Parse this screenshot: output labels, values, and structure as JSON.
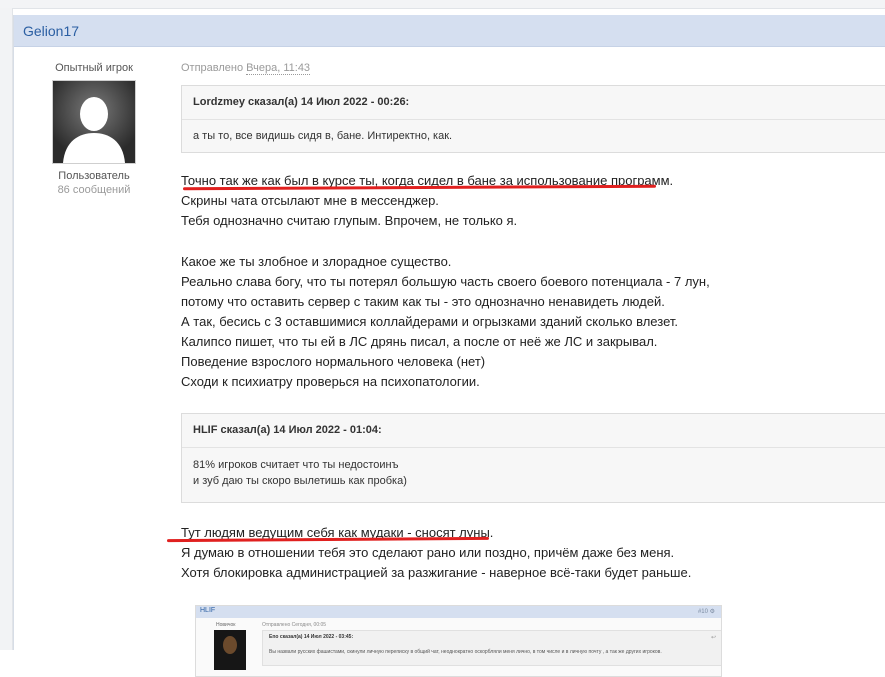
{
  "post": {
    "author": "Gelion17",
    "rank": "Опытный игрок",
    "group": "Пользователь",
    "post_count": "86 сообщений",
    "meta_prefix": "Отправлено",
    "meta_date": "Вчера, 11:43"
  },
  "quote1": {
    "header": "Lordzmey сказал(а) 14 Июл 2022 - 00:26:",
    "body": "а ты то, все видишь сидя в, бане. Интиректно, как."
  },
  "text_block1": [
    "Точно так же как был в курсе ты, когда сидел в бане за использование программ.",
    "Скрины чата отсылают мне в мессенджер.",
    "Тебя однозначно считаю глупым. Впрочем, не только я.",
    "",
    "Какое же ты злобное и злорадное существо.",
    "Реально слава богу, что ты потерял большую часть своего боевого потенциала - 7 лун,",
    "потому что оставить сервер с таким как ты - это однозначно ненавидеть людей.",
    "А так, бесись с 3 оставшимися коллайдерами и огрызками зданий сколько влезет.",
    "Калипсо пишет, что ты ей в ЛС дрянь писал, а после от неё же ЛС и закрывал.",
    "Поведение взрослого нормального человека (нет)",
    "Сходи к психиатру проверься на психопатологии."
  ],
  "quote2": {
    "header": "HLIF сказал(а) 14 Июл 2022 - 01:04:",
    "body_lines": [
      "81% игроков считает что ты недостоинъ",
      "и зуб даю ты скоро вылетишь как пробка)"
    ]
  },
  "text_block2": [
    "Тут людям ведущим себя как мудаки - сносят луны.",
    "Я думаю в отношении тебя это сделают рано или поздно, причём даже без меня.",
    "Хотя блокировка администрацией за разжигание - наверное всё-таки будет раньше."
  ],
  "embedded": {
    "name": "HLIF",
    "header_right": "#10 ⚙",
    "group": "Новичок",
    "meta": "Отправлено Сегодня, 00:05",
    "quote_header": "Eno сказал(а) 14 Июл 2022 - 03:45:",
    "quote_body": "Вы назвали русских фашистами, скинули личную переписку в общий чат, неоднократно оскорбляли меня лично, в том числе и в личную почту , а так же других игроков.",
    "quote_icon": "↩"
  },
  "colors": {
    "header_bg": "#d5dff0",
    "author_link": "#2a5ea2",
    "underline": "#e0201f"
  },
  "icons": {
    "avatar": "user-silhouette-icon"
  }
}
